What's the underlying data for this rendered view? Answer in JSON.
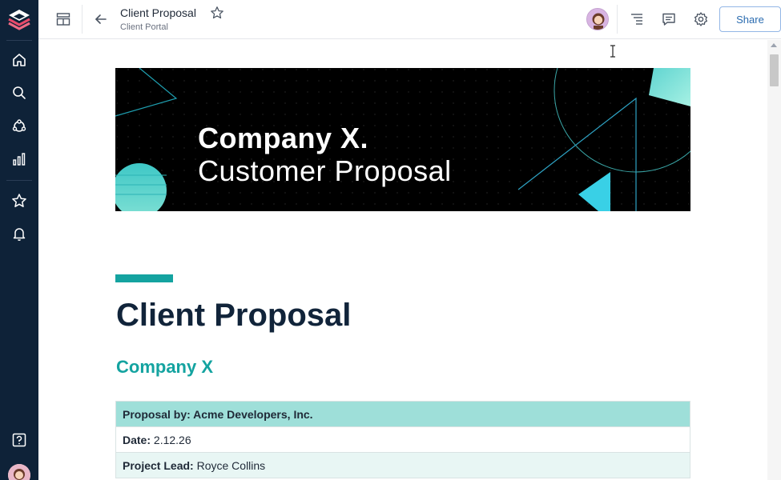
{
  "app": {
    "colors": {
      "sidebar": "#0e2238",
      "accent": "#14a3a0",
      "share_border": "#93b6e6"
    }
  },
  "sidebar": {
    "items": [
      {
        "name": "home",
        "icon": "home-icon"
      },
      {
        "name": "search",
        "icon": "search-icon"
      },
      {
        "name": "network",
        "icon": "network-icon"
      },
      {
        "name": "analytics",
        "icon": "bar-chart-icon"
      },
      {
        "name": "favorites",
        "icon": "star-icon"
      },
      {
        "name": "notifications",
        "icon": "bell-icon"
      },
      {
        "name": "help",
        "icon": "help-icon"
      }
    ]
  },
  "topbar": {
    "doc_title": "Client Proposal",
    "doc_subtitle": "Client Portal",
    "share_label": "Share"
  },
  "banner": {
    "line1": "Company X.",
    "line2": "Customer Proposal"
  },
  "document": {
    "title": "Client Proposal",
    "company": "Company X",
    "table": {
      "header": "Proposal by: Acme Developers, Inc.",
      "rows": [
        {
          "label": "Date:",
          "value": "2.12.26"
        },
        {
          "label": "Project Lead:",
          "value": "Royce Collins"
        }
      ]
    }
  }
}
